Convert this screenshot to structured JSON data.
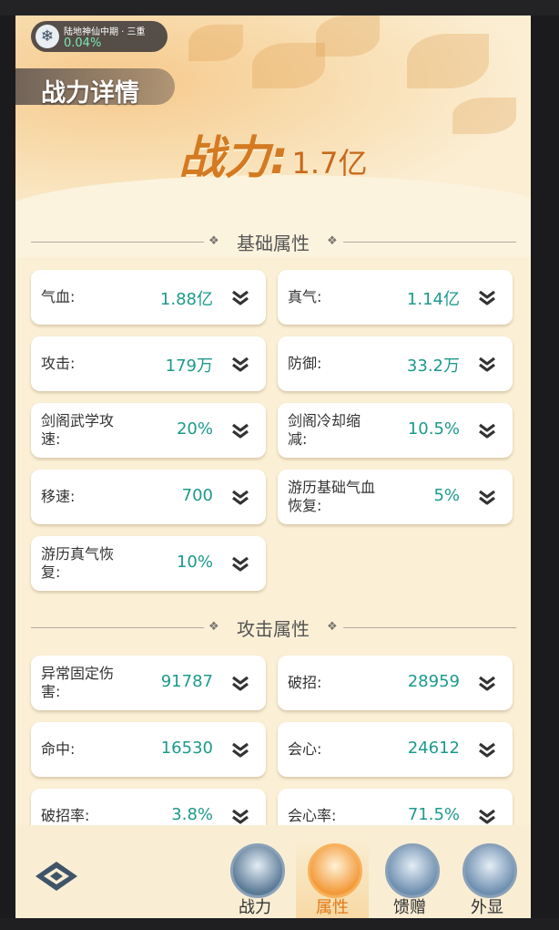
{
  "header": {
    "realm_name": "陆地神仙中期 · 三重",
    "realm_progress": "0.04%",
    "page_title": "战力详情",
    "power_label": "战力:",
    "power_value": "1.7亿"
  },
  "sections": [
    {
      "title": "基础属性",
      "items": [
        {
          "name": "气血:",
          "value": "1.88亿"
        },
        {
          "name": "真气:",
          "value": "1.14亿"
        },
        {
          "name": "攻击:",
          "value": "179万"
        },
        {
          "name": "防御:",
          "value": "33.2万"
        },
        {
          "name": "剑阁武学攻速:",
          "value": "20%"
        },
        {
          "name": "剑阁冷却缩减:",
          "value": "10.5%"
        },
        {
          "name": "移速:",
          "value": "700"
        },
        {
          "name": "游历基础气血恢复:",
          "value": "5%"
        },
        {
          "name": "游历真气恢复:",
          "value": "10%"
        }
      ]
    },
    {
      "title": "攻击属性",
      "items": [
        {
          "name": "异常固定伤害:",
          "value": "91787"
        },
        {
          "name": "破招:",
          "value": "28959"
        },
        {
          "name": "命中:",
          "value": "16530"
        },
        {
          "name": "会心:",
          "value": "24612"
        },
        {
          "name": "破招率:",
          "value": "3.8%"
        },
        {
          "name": "会心率:",
          "value": "71.5%"
        }
      ]
    }
  ],
  "tabs": [
    {
      "label": "战力",
      "icon": "swords-icon",
      "active": false
    },
    {
      "label": "属性",
      "icon": "attribute-icon",
      "active": true
    },
    {
      "label": "馈赠",
      "icon": "gift-icon",
      "active": false
    },
    {
      "label": "外显",
      "icon": "appearance-icon",
      "active": false
    }
  ],
  "colors": {
    "value_teal": "#1c9a8c",
    "power_orange": "#d37a22",
    "active_tab": "#e07a18"
  }
}
